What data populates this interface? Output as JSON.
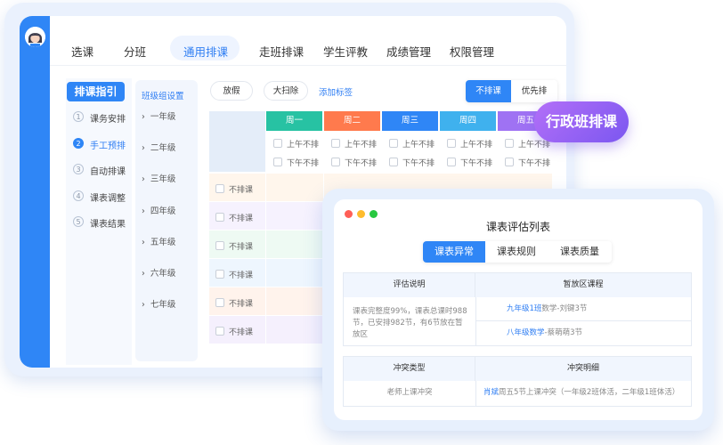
{
  "nav": {
    "tabs": [
      {
        "label": "选课"
      },
      {
        "label": "分班"
      },
      {
        "label": "通用排课"
      },
      {
        "label": "走班排课"
      },
      {
        "label": "学生评教"
      },
      {
        "label": "成绩管理"
      },
      {
        "label": "权限管理"
      }
    ],
    "active_index": 2
  },
  "guide": {
    "title": "排课指引",
    "steps": [
      {
        "num": "1",
        "label": "课务安排"
      },
      {
        "num": "2",
        "label": "手工预排"
      },
      {
        "num": "3",
        "label": "自动排课"
      },
      {
        "num": "4",
        "label": "课表调整"
      },
      {
        "num": "5",
        "label": "课表结果"
      }
    ],
    "active_step": 2
  },
  "class_groups": {
    "title": "班级组设置",
    "grades": [
      "一年级",
      "二年级",
      "三年级",
      "四年级",
      "五年级",
      "六年级",
      "七年级"
    ]
  },
  "toolbar": {
    "holiday": "放假",
    "cleanup": "大扫除",
    "add_tag": "添加标签",
    "no_schedule": "不排课",
    "priority": "优先排"
  },
  "grid": {
    "days": [
      {
        "label": "周一",
        "color": "#27c2a3"
      },
      {
        "label": "周二",
        "color": "#ff7a4d"
      },
      {
        "label": "周三",
        "color": "#2f86f6"
      },
      {
        "label": "周四",
        "color": "#3fb1ee"
      },
      {
        "label": "周五",
        "color": "#9f72f3"
      }
    ],
    "morning": "上午不排",
    "afternoon": "下午不排",
    "row_label": "不排课",
    "row_colors": [
      "#fff6ec",
      "#f6f2fe",
      "#eefaf3",
      "#eef6fe",
      "#fff3ec",
      "#f5f0fd"
    ]
  },
  "badge": "行政班排课",
  "card": {
    "title": "课表评估列表",
    "tabs": [
      "课表异常",
      "课表规则",
      "课表质量"
    ],
    "table1": {
      "head_left": "评估说明",
      "head_right": "暂放区课程",
      "desc": "课表完整度99%，课表总课时988节，已安排982节，有6节放在暂放区",
      "course1_class": "九年级1班",
      "course1_rest": "数学-刘键3节",
      "course2_class": "八年级数学",
      "course2_rest": "-蔡萌萌3节"
    },
    "table2": {
      "head_left": "冲突类型",
      "head_right": "冲突明细",
      "type": "老师上课冲突",
      "detail_name": "肖斌",
      "detail_rest": "周五5节上课冲突（一年级2班体活，二年级1班体活）"
    }
  }
}
